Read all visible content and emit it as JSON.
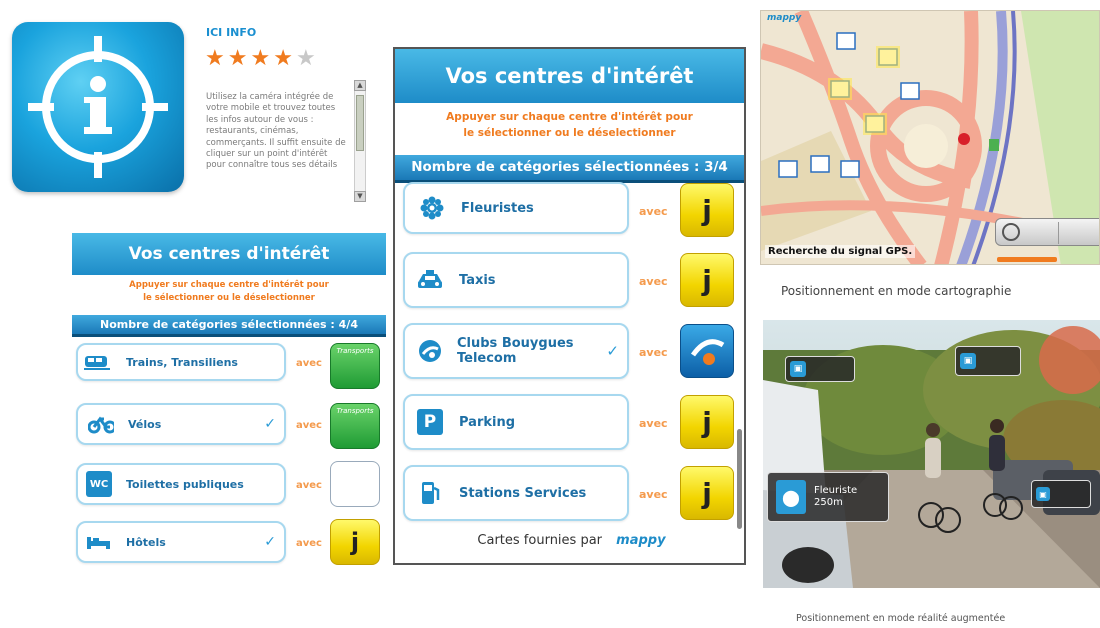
{
  "app": {
    "title": "ICI INFO",
    "rating": 4,
    "rating_max": 5,
    "description": "Utilisez la caméra intégrée de votre mobile et trouvez toutes les infos autour de vous : restaurants, cinémas, commerçants. Il suffit ensuite de cliquer sur un point d'intérêt pour connaître tous ses détails"
  },
  "left_screen": {
    "header": "Vos centres d'intérêt",
    "instruction_line1": "Appuyer sur chaque centre d'intérêt pour",
    "instruction_line2": "le sélectionner ou le déselectionner",
    "count": "Nombre de catégories sélectionnées : 4/4",
    "avec": "avec",
    "items": [
      {
        "label": "Trains, Transiliens",
        "checked": false,
        "badge": "transport",
        "badge_text": "Transports"
      },
      {
        "label": "Vélos",
        "checked": true,
        "badge": "transport",
        "badge_text": "Transports"
      },
      {
        "label": "Toilettes publiques",
        "checked": false,
        "badge": "tiles"
      },
      {
        "label": "Hôtels",
        "checked": true,
        "badge": "ici"
      }
    ]
  },
  "center_screen": {
    "header": "Vos centres d'intérêt",
    "instruction_line1": "Appuyer sur chaque centre d'intérêt pour",
    "instruction_line2": "le sélectionner ou le déselectionner",
    "count": "Nombre de catégories sélectionnées : 3/4",
    "avec": "avec",
    "items": [
      {
        "label": "Fleuristes",
        "checked": false,
        "badge": "ici"
      },
      {
        "label": "Taxis",
        "checked": false,
        "badge": "ici"
      },
      {
        "label": "Clubs Bouygues Telecom",
        "checked": true,
        "badge": "bouygues"
      },
      {
        "label": "Parking",
        "checked": false,
        "badge": "ici"
      },
      {
        "label": "Stations Services",
        "checked": false,
        "badge": "ici"
      }
    ],
    "footer": "Cartes fournies par",
    "footer_brand": "mappy"
  },
  "map": {
    "brand": "mappy",
    "gps_status": "Recherche du signal GPS.",
    "caption": "Positionnement en mode cartographie"
  },
  "ar": {
    "caption": "Positionnement en mode réalité augmentée",
    "main_tag_line1": "Fleuriste",
    "main_tag_line2": "250m"
  },
  "colors": {
    "accent_blue": "#1e8cc8",
    "instruction_orange": "#f07b1f",
    "star_on": "#f07b1f",
    "star_off": "#c8c8c8"
  }
}
